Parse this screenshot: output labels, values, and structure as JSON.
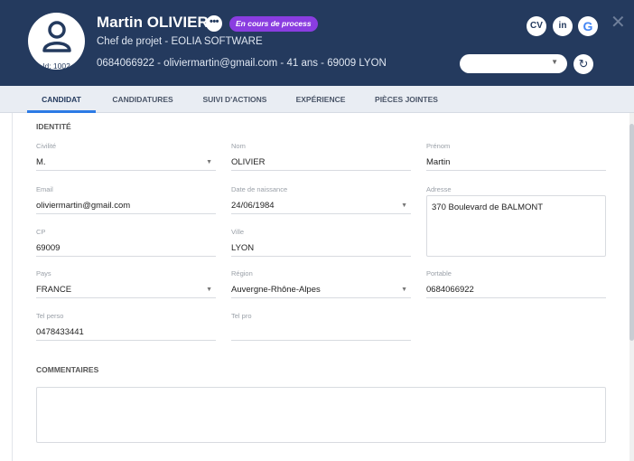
{
  "header": {
    "candidate_id": "Id: 1002",
    "name": "Martin OLIVIER",
    "more_label": "•••",
    "status": "En cours de process",
    "subtitle": "Chef de projet - EOLIA SOFTWARE",
    "contact": "0684066922 - oliviermartin@gmail.com - 41 ans - 69009 LYON",
    "cv_label": "CV",
    "linkedin_label": "in",
    "google_label": "G",
    "close_label": "✕",
    "select_value": "",
    "refresh_label": "↻",
    "colors": {
      "bar": "#243a5e",
      "badge": "#8a3de0"
    },
    "icons": [
      "avatar-icon",
      "more-icon",
      "cv-icon",
      "linkedin-icon",
      "google-icon",
      "close-icon",
      "refresh-icon",
      "chevron-down-icon"
    ]
  },
  "tabs": [
    "CANDIDAT",
    "CANDIDATURES",
    "SUIVI D'ACTIONS",
    "EXPÉRIENCE",
    "PIÈCES JOINTES"
  ],
  "active_tab": "CANDIDAT",
  "identity": {
    "title": "IDENTITÉ",
    "civilite": {
      "label": "Civilité",
      "value": "M."
    },
    "nom": {
      "label": "Nom",
      "value": "OLIVIER"
    },
    "prenom": {
      "label": "Prénom",
      "value": "Martin"
    },
    "email": {
      "label": "Email",
      "value": "oliviermartin@gmail.com"
    },
    "naissance": {
      "label": "Date de naissance",
      "value": "24/06/1984"
    },
    "adresse": {
      "label": "Adresse",
      "value": "370 Boulevard de BALMONT"
    },
    "cp": {
      "label": "CP",
      "value": "69009"
    },
    "ville": {
      "label": "Ville",
      "value": "LYON"
    },
    "pays": {
      "label": "Pays",
      "value": "FRANCE"
    },
    "region": {
      "label": "Région",
      "value": "Auvergne-Rhône-Alpes"
    },
    "portable": {
      "label": "Portable",
      "value": "0684066922"
    },
    "tel_perso": {
      "label": "Tel perso",
      "value": "0478433441"
    },
    "tel_pro": {
      "label": "Tel pro",
      "value": ""
    }
  },
  "comments": {
    "title": "COMMENTAIRES",
    "value": ""
  }
}
